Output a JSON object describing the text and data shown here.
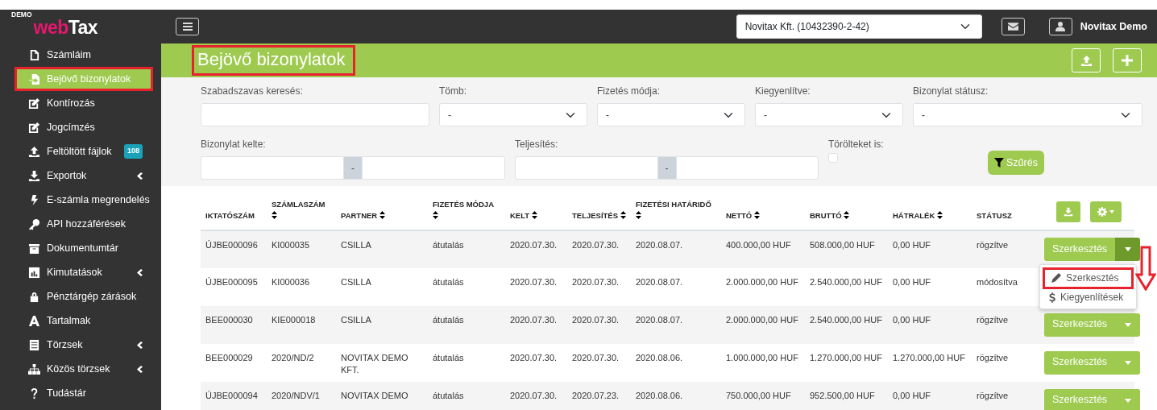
{
  "brand": {
    "badge": "DEMO",
    "logo_accent": "web",
    "logo_rest": "Tax"
  },
  "sidebar": {
    "items": [
      {
        "label": "Számláim",
        "selected": false,
        "highlighted": false,
        "has_submenu": false
      },
      {
        "label": "Bejövő bizonylatok",
        "selected": true,
        "highlighted": true,
        "has_submenu": false
      },
      {
        "label": "Kontírozás",
        "selected": false,
        "highlighted": false,
        "has_submenu": false
      },
      {
        "label": "Jogcímzés",
        "selected": false,
        "highlighted": false,
        "has_submenu": false
      },
      {
        "label": "Feltöltött fájlok",
        "selected": false,
        "highlighted": false,
        "has_submenu": false,
        "badge": "108"
      },
      {
        "label": "Exportok",
        "selected": false,
        "highlighted": false,
        "has_submenu": true
      },
      {
        "label": "E-számla megrendelés",
        "selected": false,
        "highlighted": false,
        "has_submenu": false
      },
      {
        "label": "API hozzáférések",
        "selected": false,
        "highlighted": false,
        "has_submenu": false
      },
      {
        "label": "Dokumentumtár",
        "selected": false,
        "highlighted": false,
        "has_submenu": false
      },
      {
        "label": "Kimutatások",
        "selected": false,
        "highlighted": false,
        "has_submenu": true
      },
      {
        "label": "Pénztárgép zárások",
        "selected": false,
        "highlighted": false,
        "has_submenu": false
      },
      {
        "label": "Tartalmak",
        "selected": false,
        "highlighted": false,
        "has_submenu": false
      },
      {
        "label": "Törzsek",
        "selected": false,
        "highlighted": false,
        "has_submenu": true
      },
      {
        "label": "Közös törzsek",
        "selected": false,
        "highlighted": false,
        "has_submenu": true
      },
      {
        "label": "Tudástár",
        "selected": false,
        "highlighted": false,
        "has_submenu": false
      }
    ]
  },
  "topbar": {
    "company_select": "Novitax Kft. (10432390-2-42)",
    "user": "Novitax Demo"
  },
  "page": {
    "title": "Bejövő bizonylatok",
    "title_highlighted": true
  },
  "filters": {
    "row_1": [
      {
        "kind": "text",
        "label": "Szabadszavas keresés:"
      },
      {
        "kind": "select",
        "label": "Tömb:",
        "value": "-"
      },
      {
        "kind": "select",
        "label": "Fizetés módja:",
        "value": "-"
      },
      {
        "kind": "select",
        "label": "Kiegyenlítve:",
        "value": "-"
      },
      {
        "kind": "select",
        "label": "Bizonylat státusz:",
        "value": "-"
      }
    ],
    "row_2": [
      {
        "kind": "range",
        "label": "Bizonylat kelte:",
        "separator": "-"
      },
      {
        "kind": "range",
        "label": "Teljesítés:",
        "separator": "-"
      },
      {
        "kind": "checkbox",
        "label": "Törölteket is:",
        "checked": false
      }
    ],
    "filter_button": "Szűrés"
  },
  "table": {
    "columns": [
      {
        "label": "IKTATÓSZÁM",
        "sortable": false
      },
      {
        "label": "SZÁMLASZÁM",
        "sortable": true
      },
      {
        "label": "PARTNER",
        "sortable": true
      },
      {
        "label": "FIZETÉS MÓDJA",
        "sortable": true
      },
      {
        "label": "KELT",
        "sortable": true
      },
      {
        "label": "TELJESÍTÉS",
        "sortable": true
      },
      {
        "label": "FIZETÉSI HATÁRIDŐ",
        "sortable": true
      },
      {
        "label": "NETTÓ",
        "sortable": true
      },
      {
        "label": "BRUTTÓ",
        "sortable": true
      },
      {
        "label": "HÁTRALÉK",
        "sortable": true
      },
      {
        "label": "STÁTUSZ",
        "sortable": false
      }
    ],
    "rows": [
      {
        "cells": [
          "ÚJBE000096",
          "KI000035",
          "CSILLA",
          "átutalás",
          "2020.07.30.",
          "2020.07.30.",
          "2020.08.07.",
          "400.000,00 HUF",
          "508.000,00 HUF",
          "0,00 HUF",
          "rögzítve"
        ],
        "action": "Szerkesztés",
        "menu": {
          "open": true,
          "items": [
            {
              "label": "Szerkesztés",
              "highlighted": true
            },
            {
              "label": "Kiegyenlítések",
              "highlighted": false
            }
          ]
        }
      },
      {
        "cells": [
          "ÚJBE000095",
          "KI000036",
          "CSILLA",
          "átutalás",
          "2020.07.30.",
          "2020.07.30.",
          "2020.08.07.",
          "2.000.000,00 HUF",
          "2.540.000,00 HUF",
          "0,00 HUF",
          "módosítva"
        ]
      },
      {
        "cells": [
          "BEE000030",
          "KIE000018",
          "CSILLA",
          "átutalás",
          "2020.07.30.",
          "2020.07.30.",
          "2020.08.07.",
          "2.000.000,00 HUF",
          "2.540.000,00 HUF",
          "0,00 HUF",
          "rögzítve"
        ],
        "action": "Szerkesztés"
      },
      {
        "cells": [
          "BEE000029",
          "2020/ND/2",
          "NOVITAX DEMO KFT.",
          "átutalás",
          "2020.07.30.",
          "2020.07.30.",
          "2020.08.06.",
          "1.000.000,00 HUF",
          "1.270.000,00 HUF",
          "1.270.000,00 HUF",
          "rögzítve"
        ],
        "action": "Szerkesztés"
      },
      {
        "cells": [
          "ÚJBE000094",
          "2020/NDV/1",
          "NOVITAX DEMO",
          "átutalás",
          "2020.07.30.",
          "2020.07.23.",
          "2020.08.06.",
          "750.000,00 HUF",
          "952.500,00 HUF",
          "0,00 HUF",
          "rögzítve"
        ],
        "action": "Szerkesztés"
      }
    ]
  },
  "annotation_arrow": true
}
